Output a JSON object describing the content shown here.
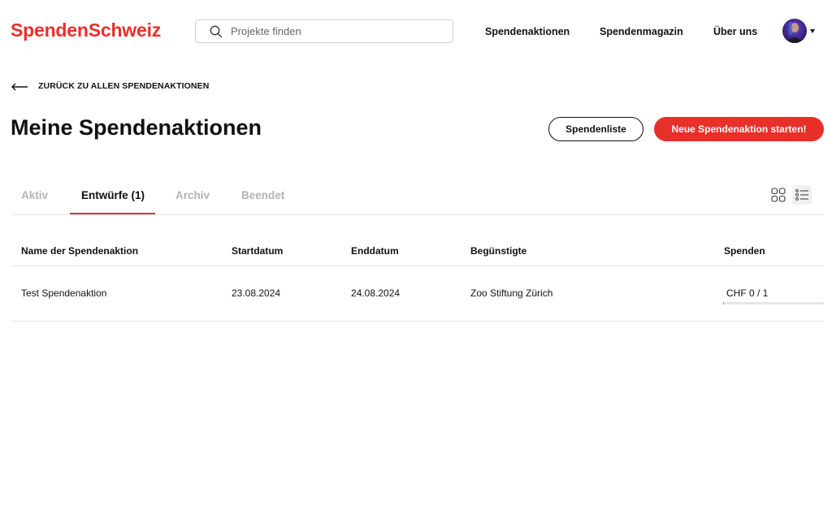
{
  "header": {
    "logo": "SpendenSchweiz",
    "search_placeholder": "Projekte finden",
    "nav": [
      "Spendenaktionen",
      "Spendenmagazin",
      "Über uns"
    ]
  },
  "back_link": "ZURÜCK ZU ALLEN SPENDENAKTIONEN",
  "page_title": "Meine Spendenaktionen",
  "buttons": {
    "list": "Spendenliste",
    "start": "Neue Spendenaktion starten!"
  },
  "tabs": [
    {
      "label": "Aktiv",
      "active": false
    },
    {
      "label": "Entwürfe (1)",
      "active": true
    },
    {
      "label": "Archiv",
      "active": false
    },
    {
      "label": "Beendet",
      "active": false
    }
  ],
  "view_mode": "list",
  "table": {
    "headers": [
      "Name der Spendenaktion",
      "Startdatum",
      "Enddatum",
      "Begünstigte",
      "Spenden"
    ],
    "rows": [
      {
        "name": "Test Spendenaktion",
        "start": "23.08.2024",
        "end": "24.08.2024",
        "beneficiary": "Zoo Stiftung Zürich",
        "donations": "CHF 0 / 1",
        "progress_fraction": 0.01
      }
    ]
  },
  "colors": {
    "brand": "#e8302a",
    "progress": "#2e9e4f"
  }
}
